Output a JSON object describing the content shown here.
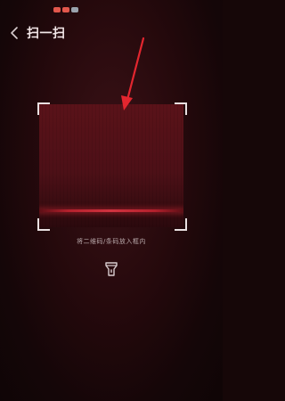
{
  "status_bar": {
    "icons": [
      {
        "name": "notification-icon-1",
        "color": "#e2574c"
      },
      {
        "name": "notification-icon-2",
        "color": "#e2574c"
      },
      {
        "name": "notification-icon-3",
        "color": "#9aa3ad"
      }
    ]
  },
  "header": {
    "back_icon": "chevron-left-icon",
    "title": "扫一扫"
  },
  "scanner": {
    "hint": "将二维码/条码放入框内",
    "flashlight_icon": "flashlight-icon"
  },
  "annotation": {
    "type": "red-arrow",
    "color": "#e3262f"
  },
  "colors": {
    "accent": "#c92a35",
    "text_primary": "#f3e7e8",
    "text_secondary": "#b8a8aa"
  }
}
